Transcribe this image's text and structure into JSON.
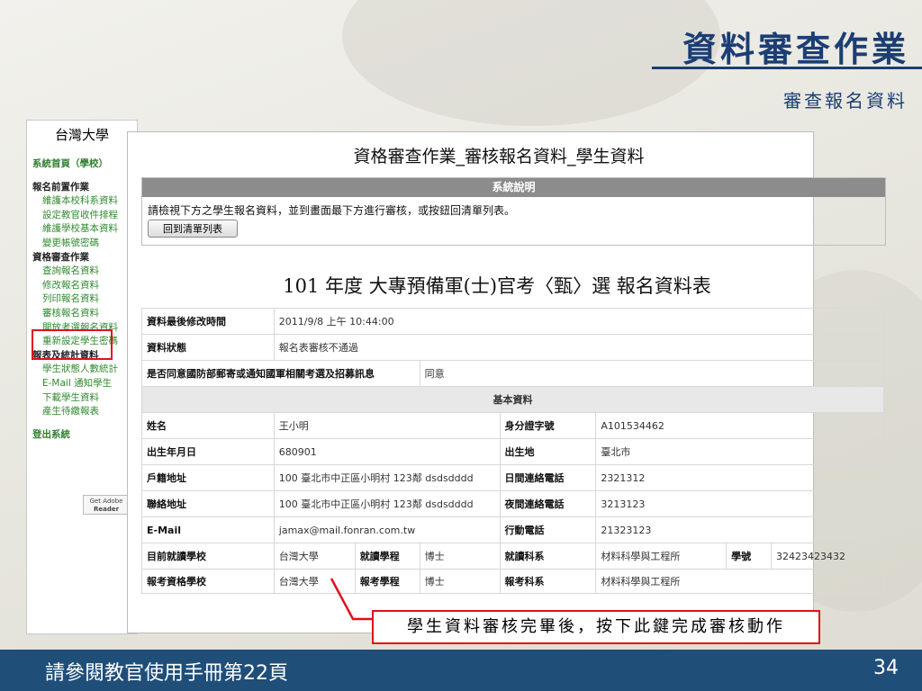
{
  "slide": {
    "title": "資料審查作業",
    "subtitle": "審查報名資料",
    "footer_note": "請參閱教官使用手冊第22頁",
    "page_number": "34",
    "callout": "學生資料審核完畢後，按下此鍵完成審核動作"
  },
  "sidebar": {
    "school": "台灣大學",
    "home": "系統首頁（學校）",
    "sections": [
      {
        "title": "報名前置作業",
        "items": [
          "維護本校科系資料",
          "設定教官收件排程",
          "維護學校基本資料",
          "變更帳號密碼"
        ]
      },
      {
        "title": "資格審查作業",
        "items": [
          "查詢報名資料",
          "修改報名資料",
          "列印報名資料",
          "審核報名資料",
          "開放考選報名資料",
          "重新設定學生密碼"
        ]
      },
      {
        "title": "報表及統計資料",
        "items": [
          "學生狀態人數統計",
          "E-Mail 通知學生",
          "下載學生資料",
          "產生待繳報表"
        ]
      }
    ],
    "logout": "登出系統",
    "adobe_line1": "Get Adobe",
    "adobe_line2": "Reader"
  },
  "main": {
    "page_title": "資格審查作業_審核報名資料_學生資料",
    "sysdesc_header": "系統說明",
    "sysdesc_text": "請檢視下方之學生報名資料，並到畫面最下方進行審核，或按鈕回清單列表。",
    "back_button": "回到清單列表",
    "form_title": "101 年度 大專預備軍(士)官考〈甄〉選 報名資料表",
    "last_modified_label": "資料最後修改時間",
    "last_modified_value": "2011/9/8 上午 10:44:00",
    "status_label": "資料狀態",
    "status_value": "報名表審核不通過",
    "consent_label": "是否同意國防部郵寄或通知國軍相關考選及招募訊息",
    "consent_value": "同意",
    "basic_section": "基本資料",
    "name_label": "姓名",
    "name_value": "王小明",
    "id_label": "身分證字號",
    "id_value": "A101534462",
    "birth_label": "出生年月日",
    "birth_value": "680901",
    "birthplace_label": "出生地",
    "birthplace_value": "臺北市",
    "reg_addr_label": "戶籍地址",
    "reg_addr_value": "100 臺北市中正區小明村 123鄰 dsdsdddd",
    "day_phone_label": "日間連絡電話",
    "day_phone_value": "2321312",
    "mail_addr_label": "聯絡地址",
    "mail_addr_value": "100 臺北市中正區小明村 123鄰 dsdsdddd",
    "night_phone_label": "夜間連絡電話",
    "night_phone_value": "3213123",
    "email_label": "E-Mail",
    "email_value": "jamax@mail.fonran.com.tw",
    "mobile_label": "行動電話",
    "mobile_value": "21323123",
    "cur_school_label": "目前就讀學校",
    "cur_school_value": "台灣大學",
    "cur_prog_label": "就讀學程",
    "cur_prog_value": "博士",
    "cur_dept_label": "就讀科系",
    "cur_dept_value": "材料科學與工程所",
    "student_no_label": "學號",
    "student_no_value": "32423423432",
    "exam_school_label": "報考資格學校",
    "exam_school_value": "台灣大學",
    "exam_prog_label": "報考學程",
    "exam_prog_value": "博士",
    "exam_dept_label": "報考科系",
    "exam_dept_value": "材料科學與工程所"
  }
}
